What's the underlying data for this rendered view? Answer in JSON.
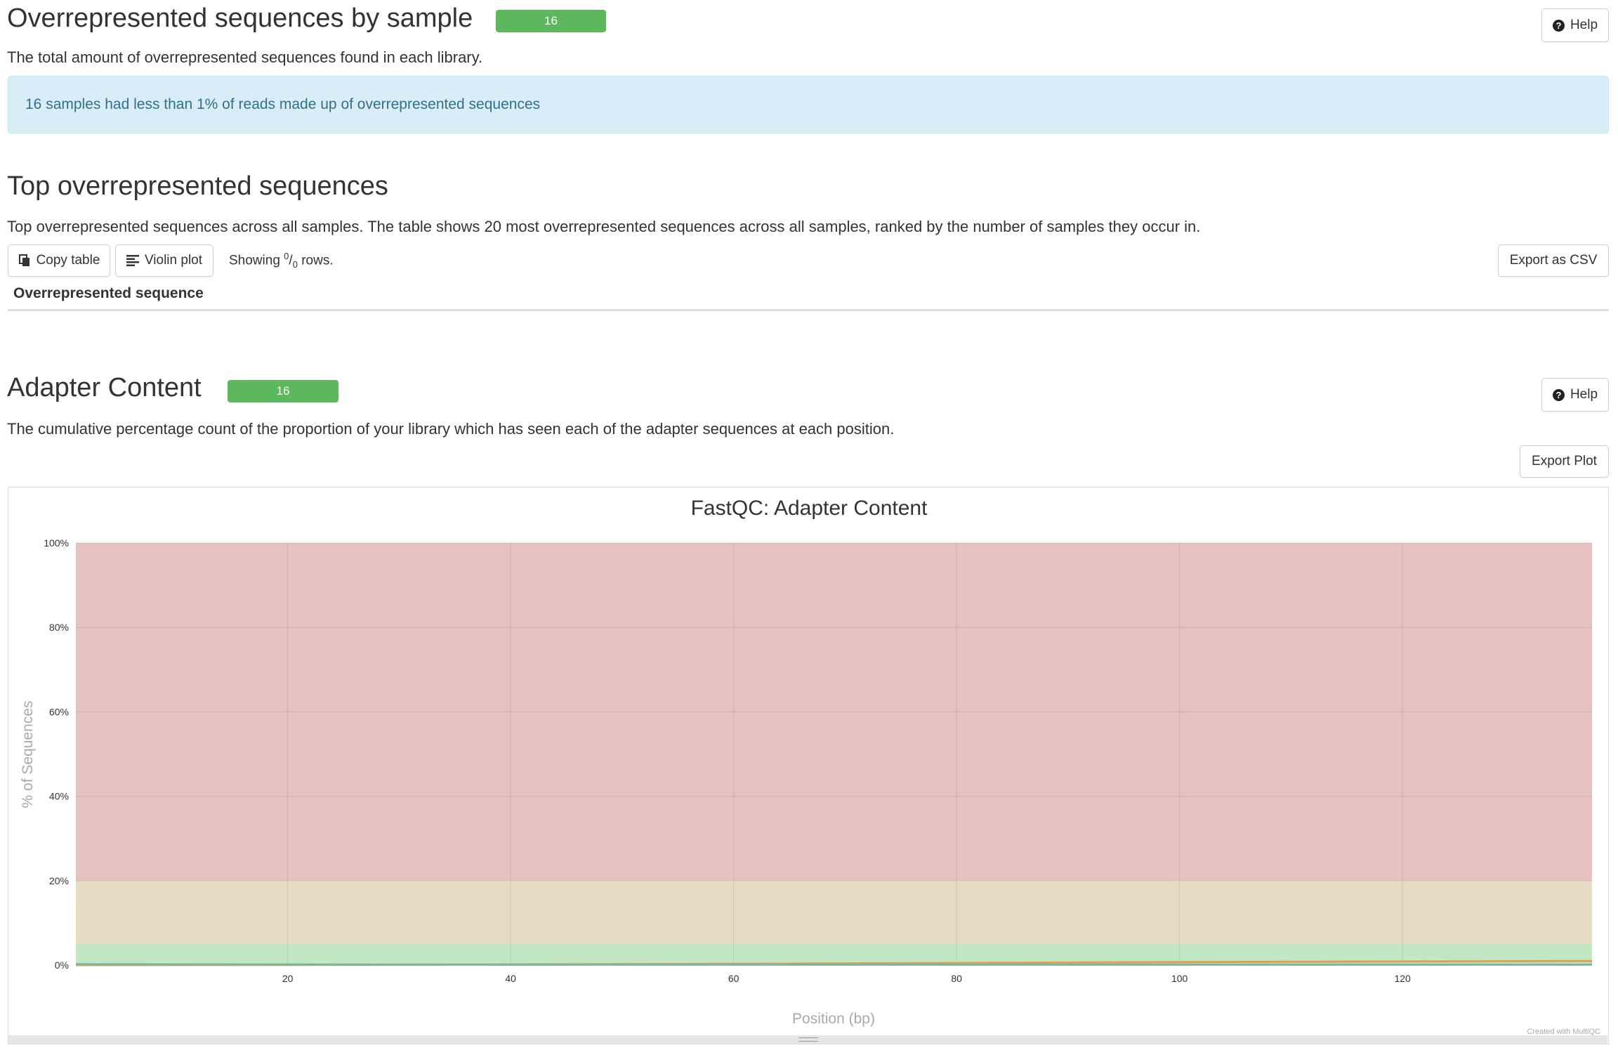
{
  "overrep_section": {
    "title": "Overrepresented sequences by sample",
    "status_count": "16",
    "help_label": "Help",
    "description": "The total amount of overrepresented sequences found in each library.",
    "alert": "16 samples had less than 1% of reads made up of overrepresented sequences"
  },
  "top_overrep_section": {
    "title": "Top overrepresented sequences",
    "description": "Top overrepresented sequences across all samples. The table shows 20 most overrepresented sequences across all samples, ranked by the number of samples they occur in.",
    "copy_table_label": "Copy table",
    "violin_plot_label": "Violin plot",
    "showing_prefix": "Showing ",
    "showing_num": "0",
    "showing_den": "0",
    "showing_suffix": " rows.",
    "export_csv_label": "Export as CSV",
    "column_header": "Overrepresented sequence"
  },
  "adapter_section": {
    "title": "Adapter Content",
    "status_count": "16",
    "help_label": "Help",
    "description": "The cumulative percentage count of the proportion of your library which has seen each of the adapter sequences at each position.",
    "export_plot_label": "Export Plot"
  },
  "icons": {
    "help": "question-circle-icon",
    "copy": "copy-icon",
    "violin": "align-left-icon",
    "resize": "resize-handle-icon"
  },
  "colors": {
    "status_green": "#5cb85c",
    "alert_bg": "#d9edf7",
    "alert_text": "#31708f",
    "band_fail": "#e6c1c1",
    "band_warn": "#e6dcc3",
    "band_pass": "#c3e6c3"
  },
  "chart_data": {
    "type": "line",
    "title": "FastQC: Adapter Content",
    "xlabel": "Position (bp)",
    "ylabel": "% of Sequences",
    "xlim": [
      1,
      137
    ],
    "ylim": [
      0,
      100
    ],
    "x_ticks": [
      20,
      40,
      60,
      80,
      100,
      120
    ],
    "y_ticks": [
      0,
      20,
      40,
      60,
      80,
      100
    ],
    "y_tick_labels": [
      "0%",
      "20%",
      "40%",
      "60%",
      "80%",
      "100%"
    ],
    "grid": true,
    "bands": [
      {
        "name": "fail",
        "from": 20,
        "to": 100,
        "color": "#e6c1c1"
      },
      {
        "name": "warn",
        "from": 5,
        "to": 20,
        "color": "#e6dcc3"
      },
      {
        "name": "pass",
        "from": 0,
        "to": 5,
        "color": "#c3e6c3"
      }
    ],
    "series": [
      {
        "color": "#e0a050",
        "x": [
          1,
          20,
          40,
          60,
          80,
          100,
          120,
          137
        ],
        "values": [
          0.0,
          0.05,
          0.15,
          0.3,
          0.5,
          0.7,
          0.85,
          0.95
        ]
      },
      {
        "color": "#7cb5a0",
        "x": [
          1,
          20,
          40,
          60,
          80,
          100,
          120,
          137
        ],
        "values": [
          0.2,
          0.15,
          0.1,
          0.1,
          0.1,
          0.1,
          0.1,
          0.1
        ]
      }
    ],
    "credit": "Created with MultiQC"
  }
}
